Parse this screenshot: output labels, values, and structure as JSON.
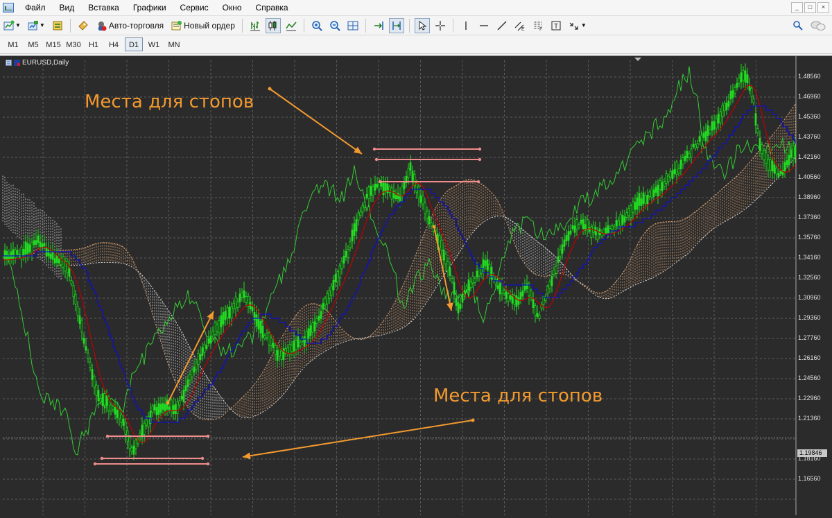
{
  "menu": {
    "items": [
      "Файл",
      "Вид",
      "Вставка",
      "Графики",
      "Сервис",
      "Окно",
      "Справка"
    ]
  },
  "window_controls": [
    "_",
    "□",
    "×"
  ],
  "toolbar": {
    "auto_trading_label": "Авто-торговля",
    "new_order_label": "Новый ордер",
    "icons": [
      "new-chart-icon",
      "profiles-icon",
      "data-window-icon",
      "navigator-icon",
      "auto-trading-icon",
      "new-order-icon",
      "bar-chart-icon",
      "candlestick-icon",
      "line-chart-icon",
      "zoom-in-icon",
      "zoom-out-icon",
      "tile-icon",
      "autoscroll-icon",
      "chart-shift-icon",
      "cursor-icon",
      "crosshair-icon",
      "vertical-line-icon",
      "horizontal-line-icon",
      "trendline-icon",
      "equidistant-channel-icon",
      "fibonacci-icon",
      "text-icon",
      "arrows-icon",
      "search-icon",
      "chat-icon"
    ]
  },
  "timeframes": [
    "M1",
    "M5",
    "M15",
    "M30",
    "H1",
    "H4",
    "D1",
    "W1",
    "MN"
  ],
  "active_timeframe": "D1",
  "chart": {
    "title": "EURUSD,Daily",
    "price_labels": [
      "1.48560",
      "1.46960",
      "1.45360",
      "1.43760",
      "1.42160",
      "1.40560",
      "1.38960",
      "1.37360",
      "1.35760",
      "1.34160",
      "1.32560",
      "1.30960",
      "1.29360",
      "1.27760",
      "1.26160",
      "1.24560",
      "1.22960",
      "1.21360",
      "1.18160",
      "1.16560"
    ],
    "current_price": "1.19846",
    "annotation_top": "Места для стопов",
    "annotation_bottom": "Места для стопов",
    "colors": {
      "background": "#2b2b2b",
      "grid": "#5c5c5c",
      "candles": "#22dd22",
      "chikou": "#33cc33",
      "tenkan": "#c00000",
      "kijun": "#1010c0",
      "cloud_bull": "#d8a070",
      "cloud_bear": "#d8d8d8",
      "annotation": "#f39a2f",
      "stop_lines": "#f08c8c"
    }
  }
}
